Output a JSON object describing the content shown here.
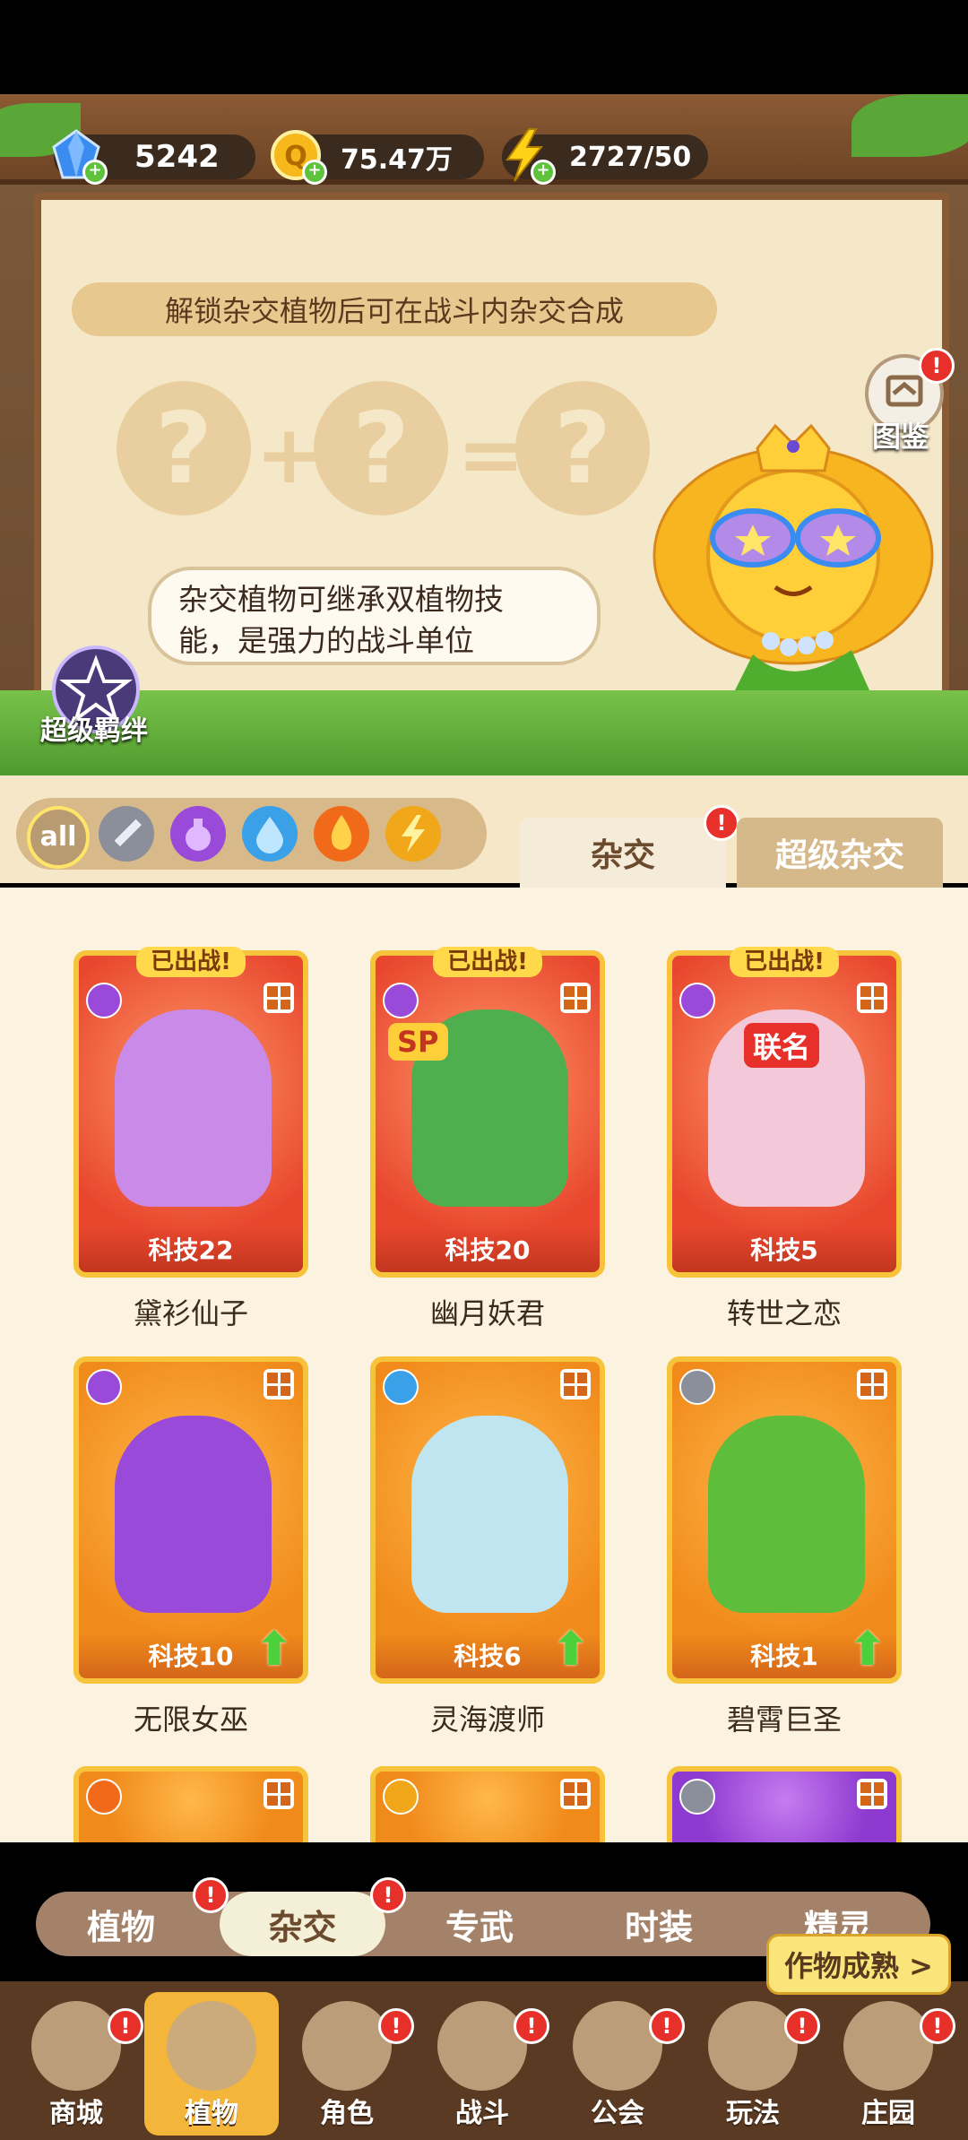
{
  "resources": {
    "gems": "5242",
    "coins": "75.47万",
    "energy": "2727/50"
  },
  "board": {
    "banner": "解锁杂交植物后可在战斗内杂交合成",
    "formula": {
      "q": "?",
      "plus": "+",
      "equals": "="
    },
    "speech_line1": "杂交植物可继承双植物技",
    "speech_line2": "能，是强力的战斗单位",
    "codex_label": "图鉴",
    "super_bond_label": "超级羁绊",
    "codex_badge": "!"
  },
  "filters": {
    "all_label": "all",
    "items": [
      "sword-icon",
      "potion-icon",
      "water-icon",
      "fire-icon",
      "lightning-icon"
    ]
  },
  "top_tabs": {
    "hybrid": "杂交",
    "super_hybrid": "超级杂交",
    "hybrid_badge": "!"
  },
  "cards": [
    {
      "name": "黛衫仙子",
      "tech": "科技22",
      "deployed": "已出战!",
      "color": "red",
      "element": "purple"
    },
    {
      "name": "幽月妖君",
      "tech": "科技20",
      "deployed": "已出战!",
      "color": "red",
      "element": "purple",
      "tag": "SP"
    },
    {
      "name": "转世之恋",
      "tech": "科技5",
      "deployed": "已出战!",
      "color": "red",
      "element": "purple",
      "tag": "联名"
    },
    {
      "name": "无限女巫",
      "tech": "科技10",
      "color": "orange",
      "element": "purple",
      "upgrade": true
    },
    {
      "name": "灵海渡师",
      "tech": "科技6",
      "color": "orange",
      "element": "blue",
      "upgrade": true
    },
    {
      "name": "碧霄巨圣",
      "tech": "科技1",
      "color": "orange",
      "element": "sword",
      "upgrade": true
    }
  ],
  "subtabs": [
    {
      "label": "植物",
      "badge": "!"
    },
    {
      "label": "杂交",
      "badge": "!",
      "active": true
    },
    {
      "label": "专武"
    },
    {
      "label": "时装"
    },
    {
      "label": "精灵"
    }
  ],
  "harvest_label": "作物成熟 >",
  "nav": [
    {
      "label": "商城",
      "badge": "!"
    },
    {
      "label": "植物",
      "active": true
    },
    {
      "label": "角色",
      "badge": "!"
    },
    {
      "label": "战斗",
      "badge": "!"
    },
    {
      "label": "公会",
      "badge": "!"
    },
    {
      "label": "玩法",
      "badge": "!"
    },
    {
      "label": "庄园",
      "badge": "!"
    }
  ]
}
